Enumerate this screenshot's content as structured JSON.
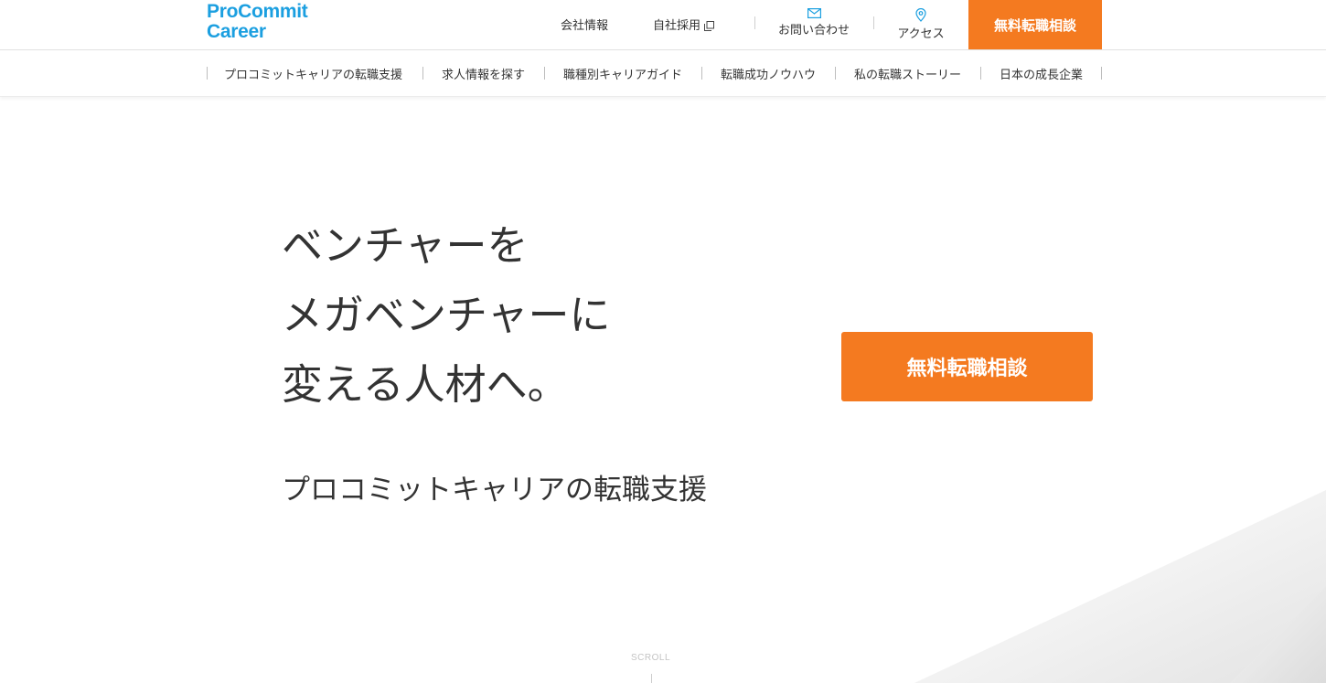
{
  "brand": {
    "line1": "ProCommit",
    "line2": "Career",
    "color": "#1b9fe0"
  },
  "header": {
    "company_info": "会社情報",
    "recruit": "自社採用",
    "contact": "お問い合わせ",
    "access": "アクセス",
    "cta": "無料転職相談",
    "icons": {
      "contact": "mail-icon",
      "access": "map-pin-icon",
      "recruit": "external-link-icon"
    }
  },
  "subnav": {
    "items": [
      "プロコミットキャリアの転職支援",
      "求人情報を探す",
      "職種別キャリアガイド",
      "転職成功ノウハウ",
      "私の転職ストーリー",
      "日本の成長企業"
    ]
  },
  "hero": {
    "lines": [
      "ベンチャーを",
      "メガベンチャーに",
      "変える人材へ。"
    ],
    "subtitle": "プロコミットキャリアの転職支援",
    "cta": "無料転職相談",
    "scroll": "SCROLL"
  },
  "colors": {
    "accent": "#f47a20",
    "text": "#333333",
    "brand": "#1b9fe0"
  }
}
